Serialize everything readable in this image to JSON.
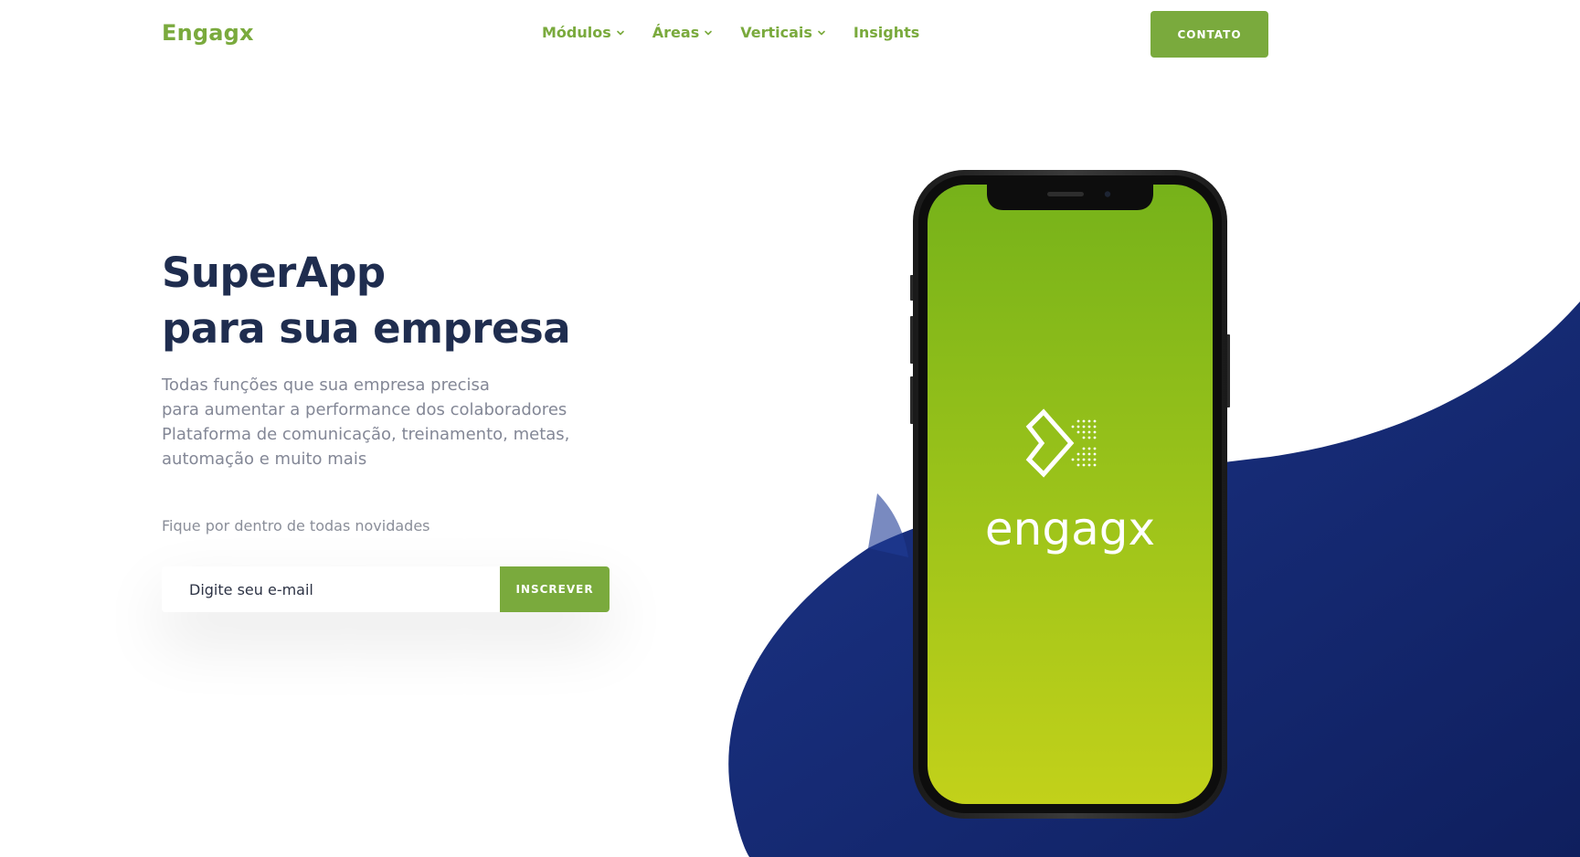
{
  "header": {
    "logo": "Engagx",
    "nav": [
      {
        "label": "Módulos",
        "has_dropdown": true
      },
      {
        "label": "Áreas",
        "has_dropdown": true
      },
      {
        "label": "Verticais",
        "has_dropdown": true
      },
      {
        "label": "Insights",
        "has_dropdown": false
      }
    ],
    "contact_label": "CONTATO"
  },
  "hero": {
    "title_line1": "SuperApp",
    "title_line2": "para sua empresa",
    "description": [
      "Todas funções que sua empresa precisa",
      "para aumentar a performance dos colaboradores",
      "Plataforma de comunicação, treinamento, metas,",
      "automação e muito mais"
    ],
    "newsletter_label": "Fique por dentro de todas novidades",
    "email_placeholder": "Digite seu e-mail",
    "subscribe_label": "INSCREVER"
  },
  "phone": {
    "brand": "engagx",
    "logo_icon": "engagx-chevron-icon"
  },
  "colors": {
    "brand_green": "#7aaa3d",
    "title_navy": "#1f2d4f",
    "blob_navy": "#152a78",
    "text_gray": "#838796",
    "screen_green_top": "#76b21a",
    "screen_green_bottom": "#c2d11a"
  }
}
